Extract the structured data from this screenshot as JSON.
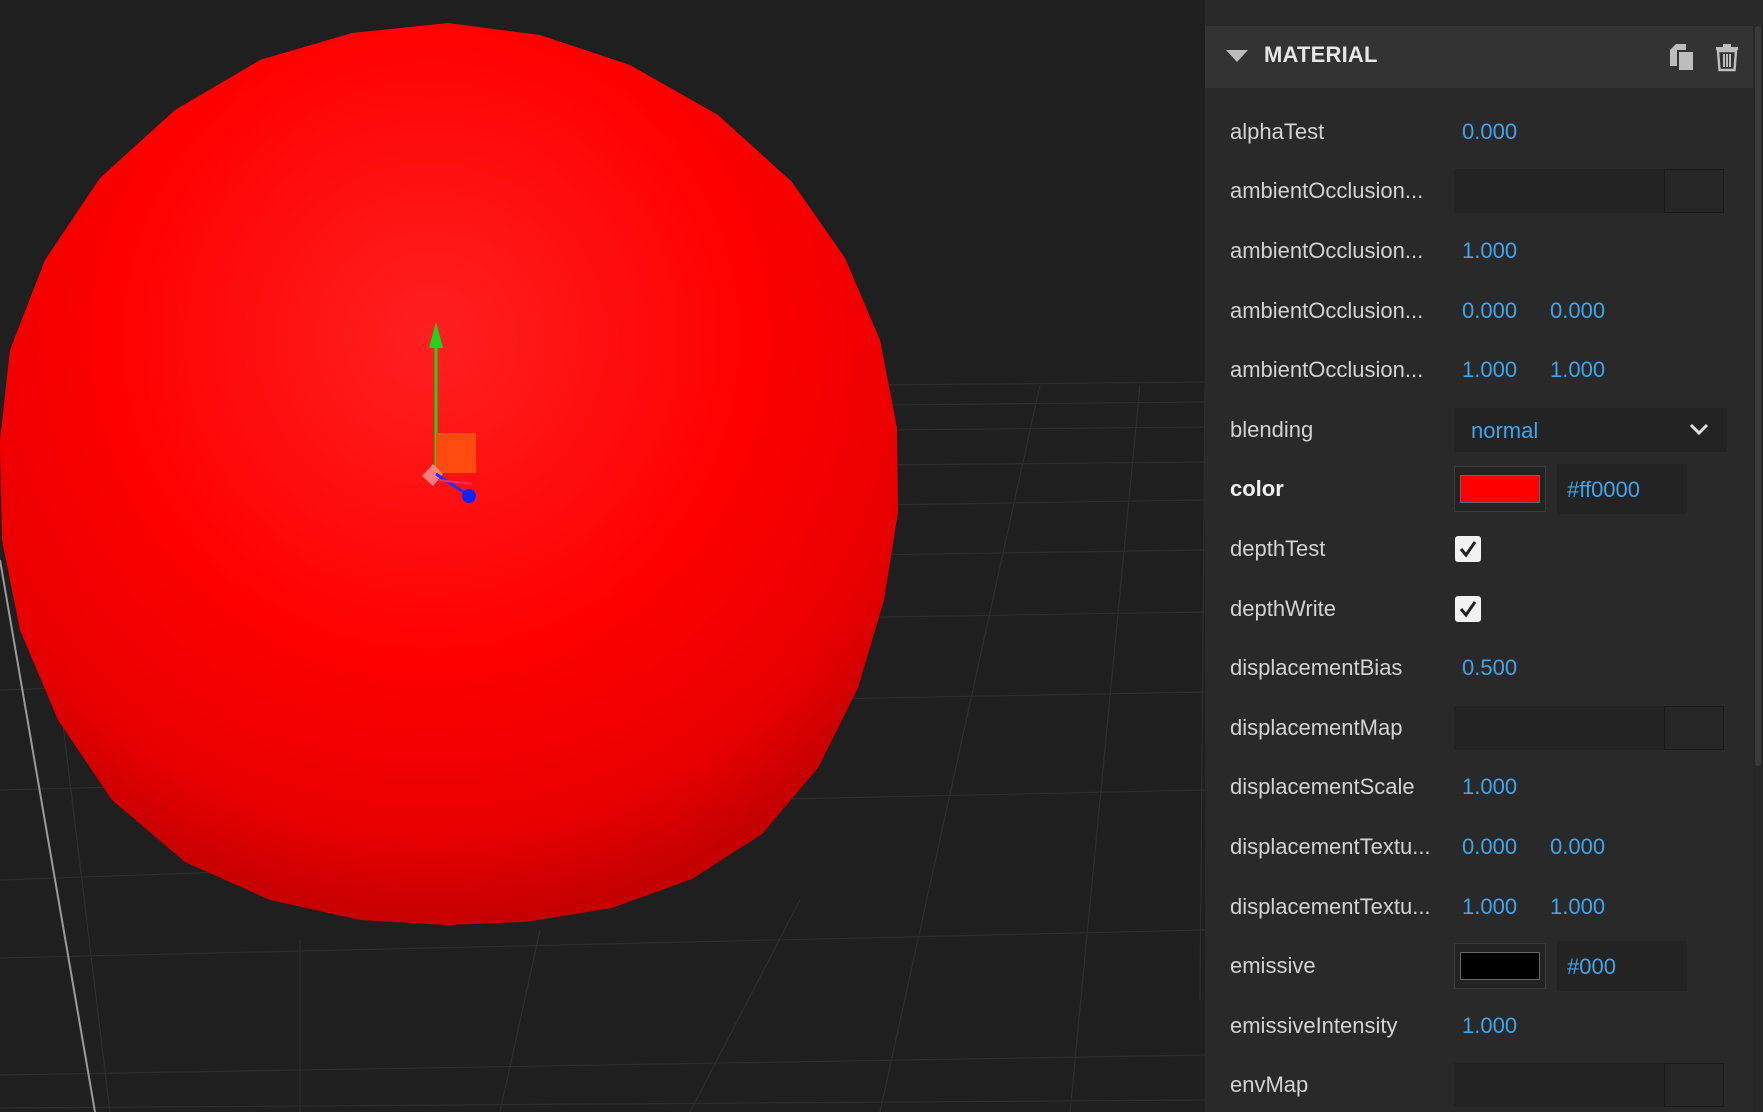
{
  "panel": {
    "section_title": "MATERIAL",
    "copy_icon": "copy-icon",
    "delete_icon": "trash-icon"
  },
  "viewport": {
    "sphere_color": "#ff0000",
    "gizmo_axes": [
      "y-axis-green",
      "z-axis-blue",
      "x-axis-red"
    ]
  },
  "properties": [
    {
      "label": "alphaTest",
      "type": "number",
      "values": [
        "0.000"
      ]
    },
    {
      "label": "ambientOcclusion...",
      "type": "texture"
    },
    {
      "label": "ambientOcclusion...",
      "type": "number",
      "values": [
        "1.000"
      ]
    },
    {
      "label": "ambientOcclusion...",
      "type": "vec2",
      "values": [
        "0.000",
        "0.000"
      ]
    },
    {
      "label": "ambientOcclusion...",
      "type": "vec2",
      "values": [
        "1.000",
        "1.000"
      ]
    },
    {
      "label": "blending",
      "type": "select",
      "value": "normal"
    },
    {
      "label": "color",
      "type": "color",
      "value": "#ff0000",
      "swatch": "#ff0000",
      "bold": true
    },
    {
      "label": "depthTest",
      "type": "checkbox",
      "checked": true
    },
    {
      "label": "depthWrite",
      "type": "checkbox",
      "checked": true
    },
    {
      "label": "displacementBias",
      "type": "number",
      "values": [
        "0.500"
      ]
    },
    {
      "label": "displacementMap",
      "type": "texture"
    },
    {
      "label": "displacementScale",
      "type": "number",
      "values": [
        "1.000"
      ]
    },
    {
      "label": "displacementTextu...",
      "type": "vec2",
      "values": [
        "0.000",
        "0.000"
      ]
    },
    {
      "label": "displacementTextu...",
      "type": "vec2",
      "values": [
        "1.000",
        "1.000"
      ]
    },
    {
      "label": "emissive",
      "type": "color",
      "value": "#000",
      "swatch": "#000000"
    },
    {
      "label": "emissiveIntensity",
      "type": "number",
      "values": [
        "1.000"
      ]
    },
    {
      "label": "envMap",
      "type": "texture"
    }
  ]
}
